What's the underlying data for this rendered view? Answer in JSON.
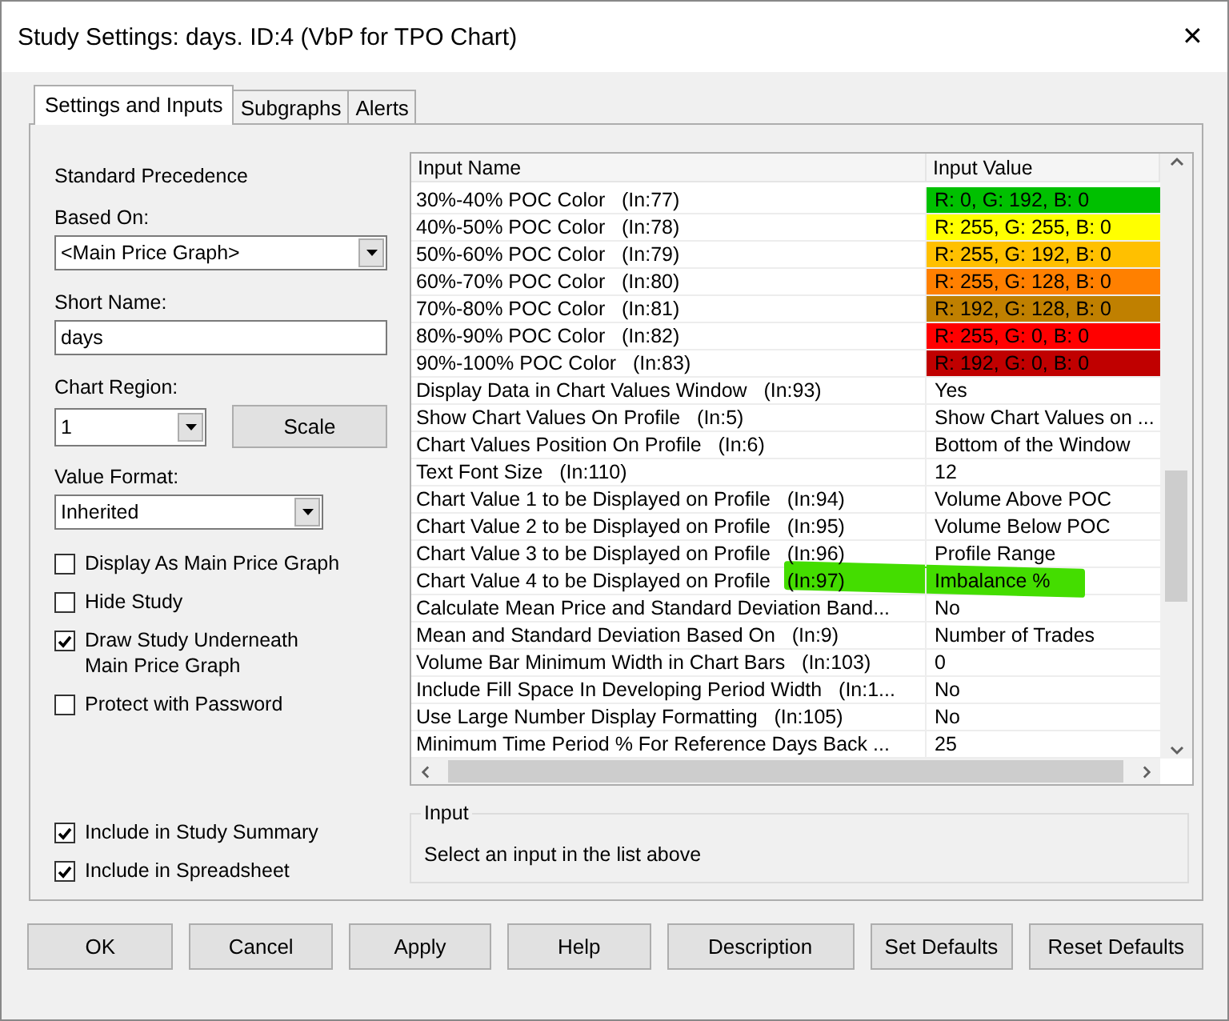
{
  "window": {
    "title": "Study Settings: days. ID:4 (VbP for TPO Chart)",
    "close": "✕"
  },
  "tabs": [
    {
      "label": "Settings and Inputs",
      "selected": true
    },
    {
      "label": "Subgraphs",
      "selected": false
    },
    {
      "label": "Alerts",
      "selected": false
    }
  ],
  "settings": {
    "precedence": "Standard Precedence",
    "based_on": {
      "label": "Based On:",
      "value": "<Main Price Graph>"
    },
    "short_name": {
      "label": "Short Name:",
      "value": "days"
    },
    "chart_region": {
      "label": "Chart Region:",
      "value": "1",
      "button": "Scale"
    },
    "value_format": {
      "label": "Value Format:",
      "value": "Inherited"
    },
    "options": [
      {
        "label": "Display As Main Price Graph",
        "checked": false
      },
      {
        "label": "Hide Study",
        "checked": false
      },
      {
        "label": "Draw Study Underneath Main Price Graph",
        "checked": true
      },
      {
        "label": "Protect with Password",
        "checked": false
      }
    ],
    "include": [
      {
        "label": "Include in Study Summary",
        "checked": true
      },
      {
        "label": "Include in Spreadsheet",
        "checked": true
      }
    ]
  },
  "inputs": {
    "columns": [
      "Input Name",
      "Input Value"
    ],
    "rows": [
      {
        "name": "30%-40% POC Color   (In:77)",
        "value": "R: 0, G: 192, B: 0",
        "color": "#00c000"
      },
      {
        "name": "40%-50% POC Color   (In:78)",
        "value": "R: 255, G: 255, B: 0",
        "color": "#ffff00"
      },
      {
        "name": "50%-60% POC Color   (In:79)",
        "value": "R: 255, G: 192, B: 0",
        "color": "#ffc000"
      },
      {
        "name": "60%-70% POC Color   (In:80)",
        "value": "R: 255, G: 128, B: 0",
        "color": "#ff8000"
      },
      {
        "name": "70%-80% POC Color   (In:81)",
        "value": "R: 192, G: 128, B: 0",
        "color": "#c08000"
      },
      {
        "name": "80%-90% POC Color   (In:82)",
        "value": "R: 255, G: 0, B: 0",
        "color": "#ff0000"
      },
      {
        "name": "90%-100% POC Color   (In:83)",
        "value": "R: 192, G: 0, B: 0",
        "color": "#c00000"
      },
      {
        "name": "Display Data in Chart Values Window   (In:93)",
        "value": "Yes"
      },
      {
        "name": "Show Chart Values On Profile   (In:5)",
        "value": "Show Chart Values on ..."
      },
      {
        "name": "Chart Values Position On Profile   (In:6)",
        "value": "Bottom of the Window"
      },
      {
        "name": "Text Font Size   (In:110)",
        "value": "12"
      },
      {
        "name": "Chart Value 1 to be Displayed on Profile   (In:94)",
        "value": "Volume Above POC"
      },
      {
        "name": "Chart Value 2 to be Displayed on Profile   (In:95)",
        "value": "Volume Below POC"
      },
      {
        "name": "Chart Value 3 to be Displayed on Profile   (In:96)",
        "value": "Profile Range"
      },
      {
        "name": "Chart Value 4 to be Displayed on Profile   (In:97)",
        "value": "Imbalance %",
        "highlighted": true
      },
      {
        "name": "Calculate Mean Price and Standard Deviation Band...",
        "value": "No"
      },
      {
        "name": "Mean and Standard Deviation Based On   (In:9)",
        "value": "Number of Trades"
      },
      {
        "name": "Volume Bar Minimum Width in Chart Bars   (In:103)",
        "value": "0"
      },
      {
        "name": "Include Fill Space In Developing Period Width   (In:1...",
        "value": "No"
      },
      {
        "name": "Use Large Number Display Formatting   (In:105)",
        "value": "No"
      },
      {
        "name": "Minimum Time Period % For Reference Days Back ...",
        "value": "25"
      }
    ]
  },
  "input_box": {
    "title": "Input",
    "text": "Select an input in the list above"
  },
  "buttons": [
    "OK",
    "Cancel",
    "Apply",
    "Help",
    "Description",
    "Set Defaults",
    "Reset Defaults"
  ]
}
